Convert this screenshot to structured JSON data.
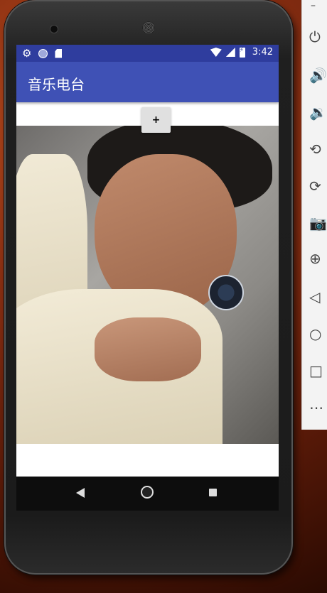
{
  "status_bar": {
    "time": "3:42",
    "left_icons": [
      "gear-icon",
      "circle-icon",
      "sdcard-icon"
    ],
    "right_icons": [
      "wifi-icon",
      "signal-icon",
      "battery-charging-icon"
    ]
  },
  "appbar": {
    "title": "音乐电台"
  },
  "main": {
    "add_label": "+"
  },
  "navigation": {
    "icons": [
      "back-icon",
      "home-icon",
      "recent-apps-icon"
    ]
  },
  "emulator_toolbar": {
    "icons": [
      "power-icon",
      "volume-up-icon",
      "volume-down-icon",
      "rotate-left-icon",
      "rotate-right-icon",
      "camera-icon",
      "zoom-icon",
      "back-icon",
      "home-icon",
      "overview-icon",
      "more-icon"
    ]
  },
  "colors": {
    "status_bar": "#2f3d9e",
    "app_bar": "#3f51b5",
    "button": "#e0e0e0"
  }
}
